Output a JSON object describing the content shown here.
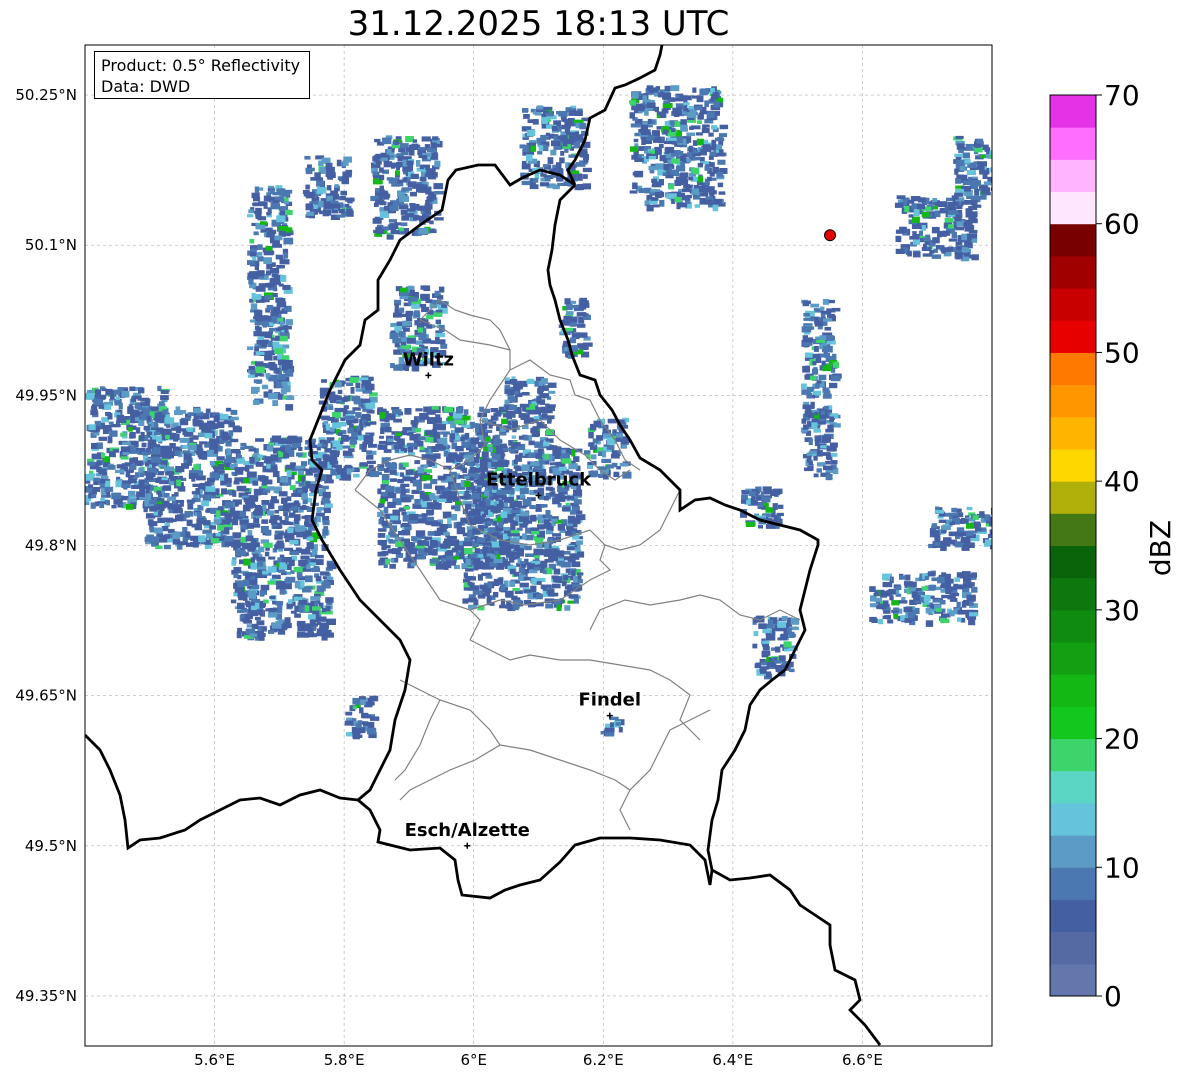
{
  "title": "31.12.2025 18:13 UTC",
  "info": {
    "product": "Product: 0.5° Reflectivity",
    "data": "Data: DWD"
  },
  "axes": {
    "lon_ticks": [
      {
        "value": 5.6,
        "label": "5.6°E"
      },
      {
        "value": 5.8,
        "label": "5.8°E"
      },
      {
        "value": 6.0,
        "label": "6°E"
      },
      {
        "value": 6.2,
        "label": "6.2°E"
      },
      {
        "value": 6.4,
        "label": "6.4°E"
      },
      {
        "value": 6.6,
        "label": "6.6°E"
      }
    ],
    "lat_ticks": [
      {
        "value": 50.25,
        "label": "50.25°N"
      },
      {
        "value": 50.1,
        "label": "50.1°N"
      },
      {
        "value": 49.95,
        "label": "49.95°N"
      },
      {
        "value": 49.8,
        "label": "49.8°N"
      },
      {
        "value": 49.65,
        "label": "49.65°N"
      },
      {
        "value": 49.5,
        "label": "49.5°N"
      },
      {
        "value": 49.35,
        "label": "49.35°N"
      }
    ],
    "lon_range": [
      5.4,
      6.8
    ],
    "lat_range": [
      49.3,
      50.3
    ],
    "grid": true
  },
  "cities": [
    {
      "name": "Wiltz",
      "lon": 5.93,
      "lat": 49.97
    },
    {
      "name": "Ettelbruck",
      "lon": 6.1,
      "lat": 49.85
    },
    {
      "name": "Findel",
      "lon": 6.21,
      "lat": 49.63
    },
    {
      "name": "Esch/Alzette",
      "lon": 5.99,
      "lat": 49.5
    }
  ],
  "radar_site": {
    "lon": 6.55,
    "lat": 50.11,
    "color": "#e60000"
  },
  "colorbar": {
    "label": "dBZ",
    "ticks": [
      "0",
      "10",
      "20",
      "30",
      "40",
      "50",
      "60",
      "70"
    ],
    "colors": [
      "#6477ac",
      "#5569a3",
      "#455fa3",
      "#4b78b1",
      "#5b9bc6",
      "#66c3dc",
      "#5cd6c4",
      "#3ed46c",
      "#12c81e",
      "#14b814",
      "#12a012",
      "#0f8c0f",
      "#0e780e",
      "#0a640a",
      "#437814",
      "#b0b00a",
      "#ffd700",
      "#ffb400",
      "#ff9600",
      "#ff7800",
      "#e60000",
      "#c80000",
      "#a00000",
      "#780000",
      "#ffe6ff",
      "#ffb4ff",
      "#ff6eff",
      "#e632e6"
    ]
  },
  "echoes": [
    {
      "lon": 5.68,
      "lat": 50.05,
      "w": 0.06,
      "h": 0.22
    },
    {
      "lon": 5.77,
      "lat": 50.16,
      "w": 0.07,
      "h": 0.06
    },
    {
      "lon": 5.46,
      "lat": 49.9,
      "w": 0.12,
      "h": 0.12
    },
    {
      "lon": 5.56,
      "lat": 49.87,
      "w": 0.14,
      "h": 0.14
    },
    {
      "lon": 5.7,
      "lat": 49.85,
      "w": 0.14,
      "h": 0.12
    },
    {
      "lon": 5.8,
      "lat": 49.92,
      "w": 0.08,
      "h": 0.1
    },
    {
      "lon": 5.7,
      "lat": 49.75,
      "w": 0.15,
      "h": 0.08
    },
    {
      "lon": 5.89,
      "lat": 50.16,
      "w": 0.1,
      "h": 0.1
    },
    {
      "lon": 5.91,
      "lat": 50.02,
      "w": 0.08,
      "h": 0.08
    },
    {
      "lon": 6.12,
      "lat": 50.2,
      "w": 0.1,
      "h": 0.08
    },
    {
      "lon": 5.95,
      "lat": 49.86,
      "w": 0.2,
      "h": 0.16
    },
    {
      "lon": 6.07,
      "lat": 49.82,
      "w": 0.18,
      "h": 0.16
    },
    {
      "lon": 6.08,
      "lat": 49.93,
      "w": 0.07,
      "h": 0.08
    },
    {
      "lon": 6.2,
      "lat": 49.9,
      "w": 0.06,
      "h": 0.06
    },
    {
      "lon": 6.31,
      "lat": 50.2,
      "w": 0.14,
      "h": 0.12
    },
    {
      "lon": 6.53,
      "lat": 49.96,
      "w": 0.05,
      "h": 0.18
    },
    {
      "lon": 6.71,
      "lat": 50.12,
      "w": 0.12,
      "h": 0.06
    },
    {
      "lon": 6.77,
      "lat": 50.18,
      "w": 0.06,
      "h": 0.06
    },
    {
      "lon": 6.69,
      "lat": 49.75,
      "w": 0.16,
      "h": 0.05
    },
    {
      "lon": 6.46,
      "lat": 49.7,
      "w": 0.06,
      "h": 0.06
    },
    {
      "lon": 6.44,
      "lat": 49.84,
      "w": 0.06,
      "h": 0.04
    },
    {
      "lon": 6.15,
      "lat": 50.02,
      "w": 0.04,
      "h": 0.06
    },
    {
      "lon": 5.82,
      "lat": 49.63,
      "w": 0.04,
      "h": 0.04
    },
    {
      "lon": 6.21,
      "lat": 49.62,
      "w": 0.03,
      "h": 0.02
    },
    {
      "lon": 6.75,
      "lat": 49.82,
      "w": 0.1,
      "h": 0.04
    }
  ]
}
